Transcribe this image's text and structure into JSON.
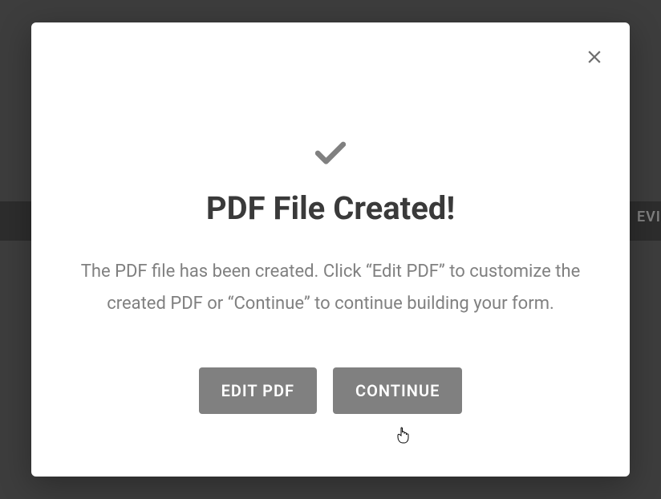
{
  "background": {
    "partial_label": "EVI"
  },
  "modal": {
    "title": "PDF File Created!",
    "body": "The PDF file has been created. Click “Edit PDF” to customize the created PDF or “Continue” to continue building your form.",
    "buttons": {
      "edit": "EDIT PDF",
      "continue": "CONTINUE"
    }
  }
}
